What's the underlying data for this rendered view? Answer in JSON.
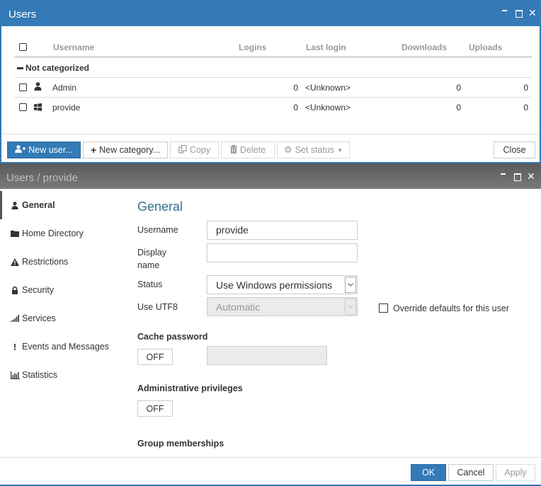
{
  "users_window": {
    "title": "Users",
    "columns": {
      "username": "Username",
      "logins": "Logins",
      "last_login": "Last login",
      "downloads": "Downloads",
      "uploads": "Uploads"
    },
    "category": "Not categorized",
    "rows": [
      {
        "icon": "user-icon",
        "username": "Admin",
        "logins": "0",
        "last_login": "<Unknown>",
        "downloads": "0",
        "uploads": "0"
      },
      {
        "icon": "windows-icon",
        "username": "provide",
        "logins": "0",
        "last_login": "<Unknown>",
        "downloads": "0",
        "uploads": "0"
      }
    ],
    "toolbar": {
      "new_user": "New user...",
      "new_category": "New category...",
      "copy": "Copy",
      "delete": "Delete",
      "set_status": "Set status",
      "close": "Close"
    },
    "colors": {
      "titlebar": "#337ab7"
    }
  },
  "user_window": {
    "title": "Users / provide",
    "sidebar": [
      {
        "label": "General",
        "icon": "user-icon",
        "active": true
      },
      {
        "label": "Home Directory",
        "icon": "folder-icon"
      },
      {
        "label": "Restrictions",
        "icon": "warning-icon"
      },
      {
        "label": "Security",
        "icon": "lock-icon"
      },
      {
        "label": "Services",
        "icon": "signal-icon"
      },
      {
        "label": "Events and Messages",
        "icon": "exclamation-icon"
      },
      {
        "label": "Statistics",
        "icon": "bar-chart-icon"
      }
    ],
    "general": {
      "heading": "General",
      "username_label": "Username",
      "username_value": "provide",
      "display_name_label_1": "Display",
      "display_name_label_2": "name",
      "display_name_value": "",
      "status_label": "Status",
      "status_value": "Use Windows permissions",
      "utf8_label": "Use UTF8",
      "utf8_value": "Automatic",
      "override_label": "Override defaults for this user",
      "cache_password_label": "Cache password",
      "cache_password_toggle": "OFF",
      "admin_privileges_label": "Administrative privileges",
      "admin_privileges_toggle": "OFF",
      "group_memberships_label": "Group memberships"
    },
    "footer": {
      "ok": "OK",
      "cancel": "Cancel",
      "apply": "Apply"
    }
  }
}
